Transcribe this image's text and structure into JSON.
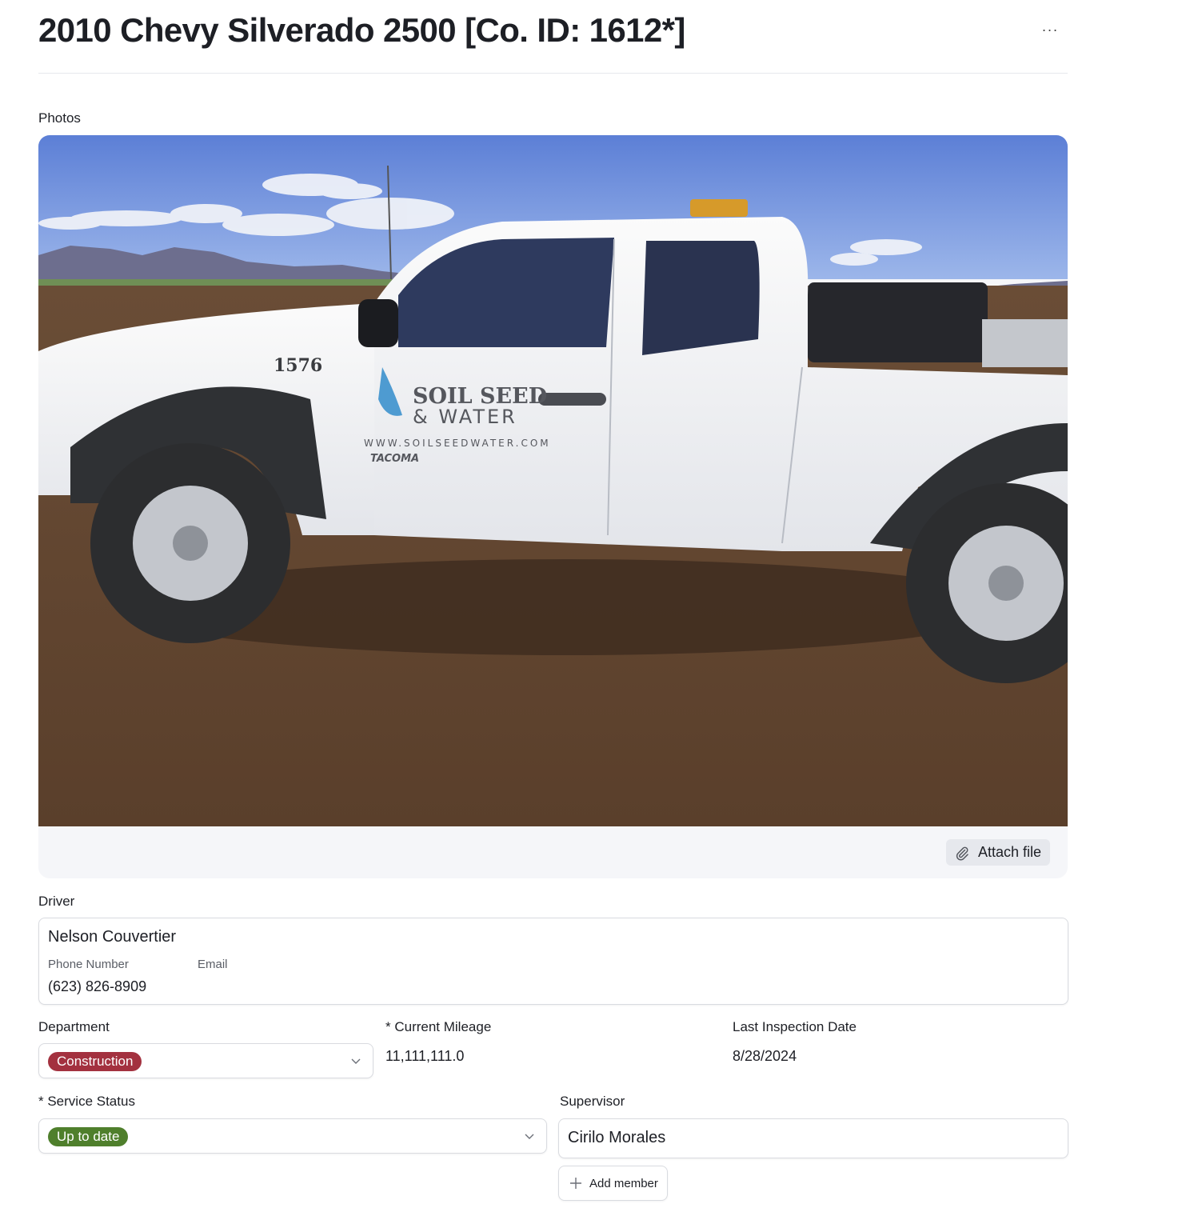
{
  "header": {
    "title": "2010 Chevy Silverado 2500 [Co. ID: 1612*]",
    "more_label": "···"
  },
  "photos": {
    "label": "Photos",
    "attach_label": "Attach file",
    "photo": {
      "truck_number": "1576",
      "logo_line1": "SOIL SEED",
      "logo_line2": "& WATER",
      "website": "WWW.SOILSEEDWATER.COM",
      "model": "TACOMA"
    }
  },
  "driver": {
    "label": "Driver",
    "name": "Nelson Couvertier",
    "phone_label": "Phone Number",
    "email_label": "Email",
    "phone": "(623) 826-8909"
  },
  "department": {
    "label": "Department",
    "value": "Construction",
    "color": "#a3313f"
  },
  "mileage": {
    "label": "* Current Mileage",
    "value": "11,111,111.0"
  },
  "inspection": {
    "label": "Last Inspection Date",
    "value": "8/28/2024"
  },
  "service_status": {
    "label": "* Service Status",
    "value": "Up to date",
    "color": "#4f7f2c"
  },
  "supervisor": {
    "label": "Supervisor",
    "name": "Cirilo Morales",
    "add_label": "Add member"
  },
  "icons": {
    "more": "more-horizontal-icon",
    "attach": "paperclip-icon",
    "dropdown": "chevron-down-icon",
    "add": "plus-icon"
  }
}
